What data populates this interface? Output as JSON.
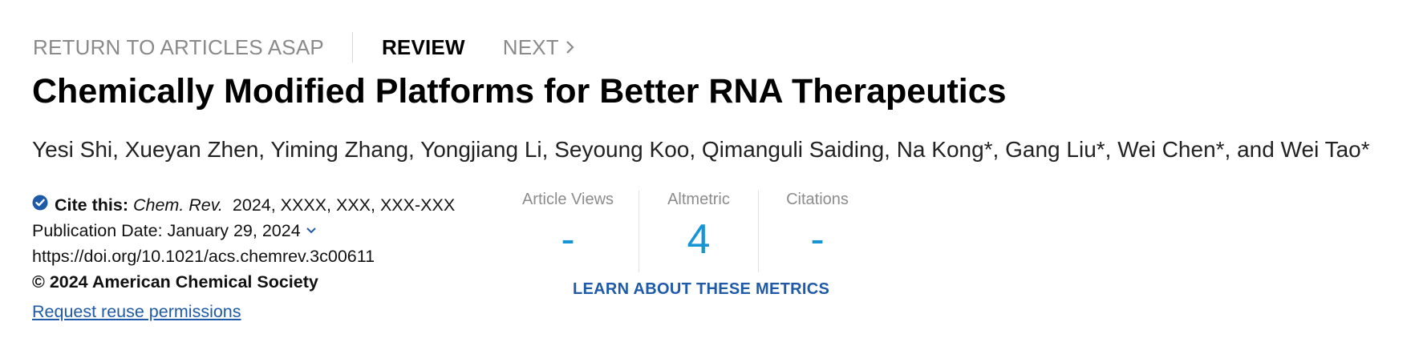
{
  "nav": {
    "return_label": "RETURN TO ARTICLES ASAP",
    "review_label": "REVIEW",
    "next_label": "NEXT"
  },
  "article": {
    "title": "Chemically Modified Platforms for Better RNA Therapeutics",
    "authors": "Yesi Shi, Xueyan Zhen, Yiming Zhang, Yongjiang Li, Seyoung Koo, Qimanguli Saiding, Na Kong*, Gang Liu*, Wei Chen*, and Wei Tao*"
  },
  "citation": {
    "label": "Cite this:",
    "journal": "Chem. Rev.",
    "details": "2024, XXXX, XXX, XXX-XXX",
    "publication_date": "Publication Date: January 29, 2024",
    "doi": "https://doi.org/10.1021/acs.chemrev.3c00611",
    "copyright": "© 2024 American Chemical Society",
    "reuse_link": "Request reuse permissions"
  },
  "metrics": {
    "items": [
      {
        "label": "Article Views",
        "value": "-"
      },
      {
        "label": "Altmetric",
        "value": "4"
      },
      {
        "label": "Citations",
        "value": "-"
      }
    ],
    "learn_link": "LEARN ABOUT THESE METRICS"
  },
  "colors": {
    "accent_blue": "#1794d3",
    "link_blue": "#1e5aa8",
    "muted_gray": "#8a8a8a"
  },
  "icons": {
    "cite": "check-circle-icon",
    "date_toggle": "chevron-down-icon",
    "next": "chevron-right-icon"
  }
}
